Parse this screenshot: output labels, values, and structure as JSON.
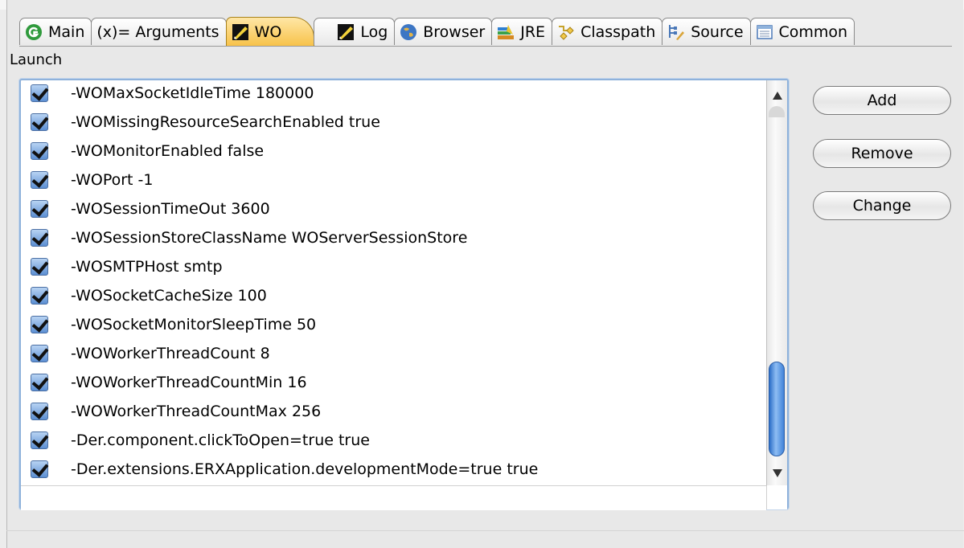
{
  "tabs": [
    {
      "label": "Main",
      "icon": "main-launch-icon"
    },
    {
      "label": "(x)= Arguments",
      "icon": "arguments-icon"
    },
    {
      "label": "WO",
      "icon": "wo-icon"
    },
    {
      "label": "Log",
      "icon": "log-icon"
    },
    {
      "label": "Browser",
      "icon": "globe-icon"
    },
    {
      "label": "JRE",
      "icon": "jre-icon"
    },
    {
      "label": "Classpath",
      "icon": "classpath-icon"
    },
    {
      "label": "Source",
      "icon": "source-icon"
    },
    {
      "label": "Common",
      "icon": "common-icon"
    }
  ],
  "active_tab": "WO",
  "section_label": "Launch",
  "launch_args": [
    {
      "text": "-WOMaxSocketIdleTime 180000",
      "checked": true
    },
    {
      "text": "-WOMissingResourceSearchEnabled true",
      "checked": true
    },
    {
      "text": "-WOMonitorEnabled false",
      "checked": true
    },
    {
      "text": "-WOPort -1",
      "checked": true
    },
    {
      "text": "-WOSessionTimeOut 3600",
      "checked": true
    },
    {
      "text": "-WOSessionStoreClassName WOServerSessionStore",
      "checked": true
    },
    {
      "text": "-WOSMTPHost smtp",
      "checked": true
    },
    {
      "text": "-WOSocketCacheSize 100",
      "checked": true
    },
    {
      "text": "-WOSocketMonitorSleepTime 50",
      "checked": true
    },
    {
      "text": "-WOWorkerThreadCount 8",
      "checked": true
    },
    {
      "text": "-WOWorkerThreadCountMin 16",
      "checked": true
    },
    {
      "text": "-WOWorkerThreadCountMax 256",
      "checked": true
    },
    {
      "text": "-Der.component.clickToOpen=true true",
      "checked": true
    },
    {
      "text": "-Der.extensions.ERXApplication.developmentMode=true true",
      "checked": true
    }
  ],
  "buttons": {
    "add": "Add",
    "remove": "Remove",
    "change": "Change"
  },
  "colors": {
    "active_tab": "#f7c24a",
    "focus_ring": "#8fb2db",
    "scroll_thumb": "#3f82d9"
  }
}
